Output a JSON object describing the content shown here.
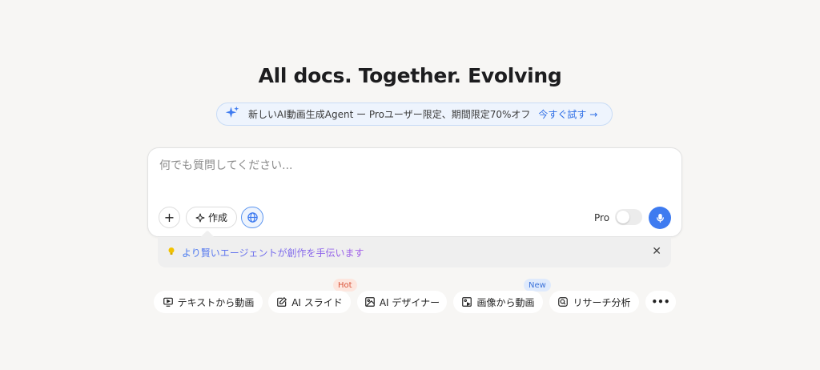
{
  "hero": {
    "title": "All docs. Together. Evolving"
  },
  "promo": {
    "icon": "sparkle-icon",
    "text": "新しいAI動画生成Agent ー Proユーザー限定、期間限定70%オフ",
    "link": "今すぐ試す →"
  },
  "composer": {
    "placeholder": "何でも質問してください...",
    "value": "",
    "add_label": "+",
    "create_label": "作成",
    "pro_label": "Pro",
    "pro_enabled": false,
    "accent": "#3e7bf0"
  },
  "tip": {
    "text": "より賢いエージェントが創作を手伝います",
    "close": "✕"
  },
  "chips": [
    {
      "label": "テキストから動画",
      "icon": "video-play-icon"
    },
    {
      "label": "AI スライド",
      "icon": "edit-slide-icon",
      "badge": "Hot"
    },
    {
      "label": "AI デザイナー",
      "icon": "image-icon"
    },
    {
      "label": "画像から動画",
      "icon": "image-video-icon",
      "badge": "New"
    },
    {
      "label": "リサーチ分析",
      "icon": "research-icon"
    },
    {
      "label": "•••",
      "icon": "more-icon"
    }
  ]
}
